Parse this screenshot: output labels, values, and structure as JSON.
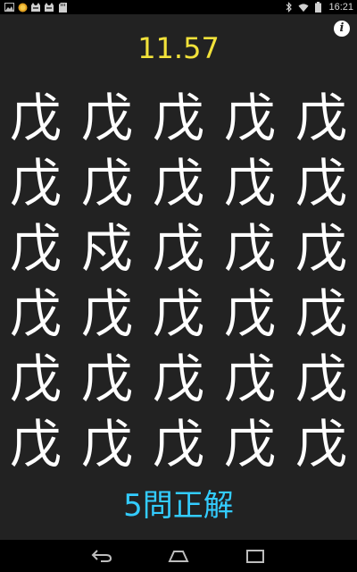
{
  "status_bar": {
    "time": "16:21",
    "left_icons": [
      "image-icon",
      "coin-icon",
      "cat-notification-icon",
      "cat-notification-icon",
      "sd-card-icon"
    ],
    "right_icons": [
      "bluetooth-icon",
      "wifi-icon",
      "battery-icon"
    ]
  },
  "header": {
    "timer": "11.57",
    "info_icon_glyph": "i"
  },
  "grid": {
    "columns": 5,
    "rows": 6,
    "cells": [
      "戊",
      "戊",
      "戊",
      "戊",
      "戊",
      "戊",
      "戊",
      "戊",
      "戊",
      "戊",
      "戊",
      "戍",
      "戊",
      "戊",
      "戊",
      "戊",
      "戊",
      "戊",
      "戊",
      "戊",
      "戊",
      "戊",
      "戊",
      "戊",
      "戊",
      "戊",
      "戊",
      "戊",
      "戊",
      "戊"
    ]
  },
  "result": {
    "text": "5問正解"
  },
  "colors": {
    "background": "#222222",
    "timer": "#f2e23a",
    "result": "#33ccff",
    "glyph": "#ffffff"
  }
}
